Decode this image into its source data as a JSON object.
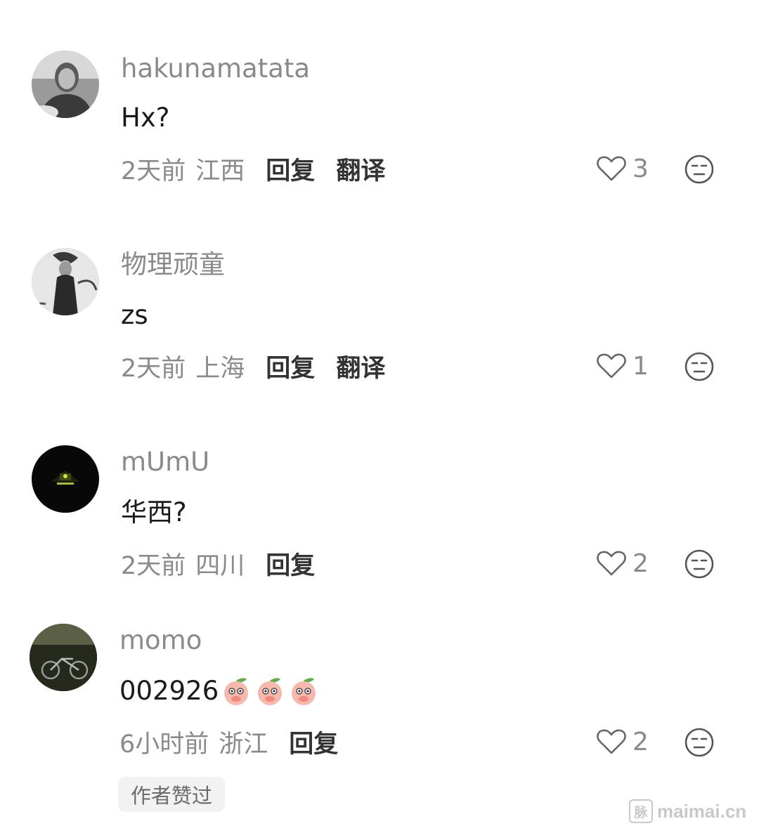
{
  "comments": [
    {
      "username": "hakunamatata",
      "text": "Hx?",
      "time": "2天前",
      "location": "江西",
      "reply_label": "回复",
      "translate_label": "翻译",
      "likes": "3"
    },
    {
      "username": "物理顽童",
      "text": "zs",
      "time": "2天前",
      "location": "上海",
      "reply_label": "回复",
      "translate_label": "翻译",
      "likes": "1"
    },
    {
      "username": "mUmU",
      "text": "华西?",
      "time": "2天前",
      "location": "四川",
      "reply_label": "回复",
      "likes": "2"
    },
    {
      "username": "momo",
      "text": "002926",
      "emojis": [
        "peach-emoji",
        "peach-emoji",
        "peach-emoji"
      ],
      "time": "6小时前",
      "location": "浙江",
      "reply_label": "回复",
      "likes": "2",
      "author_badge": "作者赞过"
    }
  ],
  "icons": {
    "like": "heart-outline-icon",
    "dislike": "unamused-face-icon"
  },
  "watermark": {
    "box_glyph": "脉",
    "text": "maimai.cn"
  },
  "colors": {
    "username": "#8a8a8a",
    "text": "#1a1a1a",
    "action": "#333333",
    "badge_bg": "#f2f2f2"
  }
}
